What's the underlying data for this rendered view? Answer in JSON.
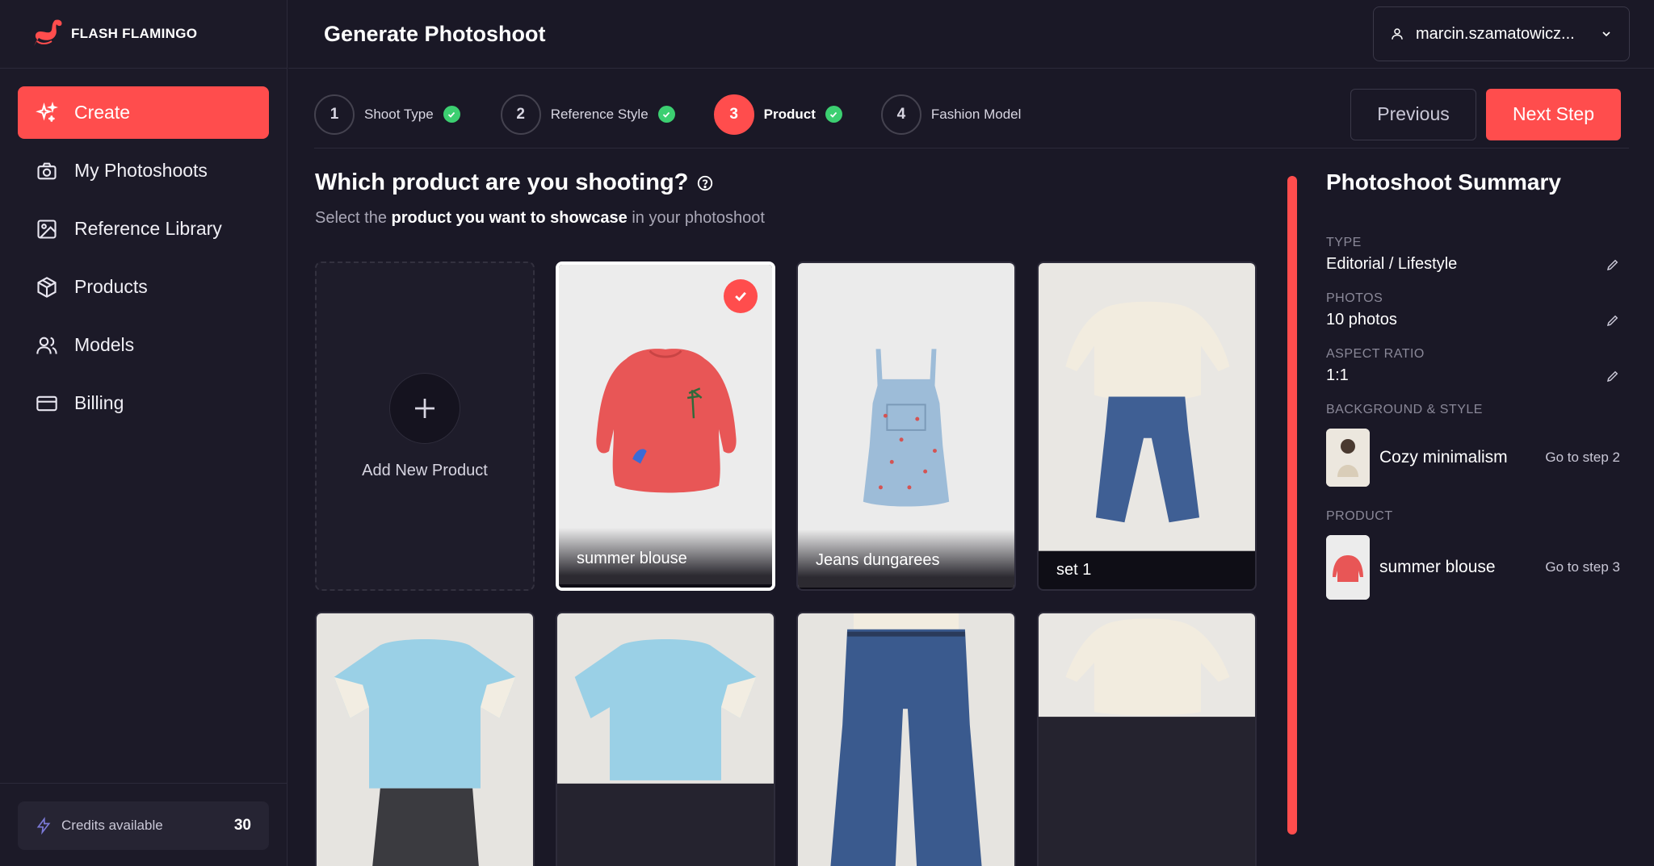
{
  "brand": {
    "name": "FLASH FLAMINGO",
    "accent": "#ff4d4d"
  },
  "header": {
    "title": "Generate Photoshoot",
    "user": "marcin.szamatowicz..."
  },
  "sidebar": {
    "items": [
      {
        "label": "Create",
        "icon": "sparkles-icon"
      },
      {
        "label": "My Photoshoots",
        "icon": "camera-icon"
      },
      {
        "label": "Reference Library",
        "icon": "image-icon"
      },
      {
        "label": "Products",
        "icon": "box-icon"
      },
      {
        "label": "Models",
        "icon": "users-icon"
      },
      {
        "label": "Billing",
        "icon": "card-icon"
      }
    ],
    "credits_label": "Credits available",
    "credits_value": "30"
  },
  "stepper": {
    "steps": [
      {
        "num": "1",
        "label": "Shoot Type",
        "done": true
      },
      {
        "num": "2",
        "label": "Reference Style",
        "done": true
      },
      {
        "num": "3",
        "label": "Product",
        "done": true
      },
      {
        "num": "4",
        "label": "Fashion Model",
        "done": false
      }
    ],
    "prev_label": "Previous",
    "next_label": "Next Step"
  },
  "main": {
    "question": "Which product are you shooting?",
    "sub_pre": "Select the ",
    "sub_bold": "product you want to showcase",
    "sub_post": " in your photoshoot",
    "add_label": "Add New Product",
    "products": [
      {
        "name": "summer blouse"
      },
      {
        "name": "Jeans dungarees"
      },
      {
        "name": "set 1"
      }
    ]
  },
  "summary": {
    "title": "Photoshoot Summary",
    "type_label": "TYPE",
    "type_value": "Editorial / Lifestyle",
    "photos_label": "PHOTOS",
    "photos_value": "10 photos",
    "ratio_label": "ASPECT RATIO",
    "ratio_value": "1:1",
    "bg_label": "BACKGROUND & STYLE",
    "bg_value": "Cozy minimalism",
    "bg_goto": "Go to step 2",
    "product_label": "PRODUCT",
    "product_value": "summer blouse",
    "product_goto": "Go to step 3"
  }
}
